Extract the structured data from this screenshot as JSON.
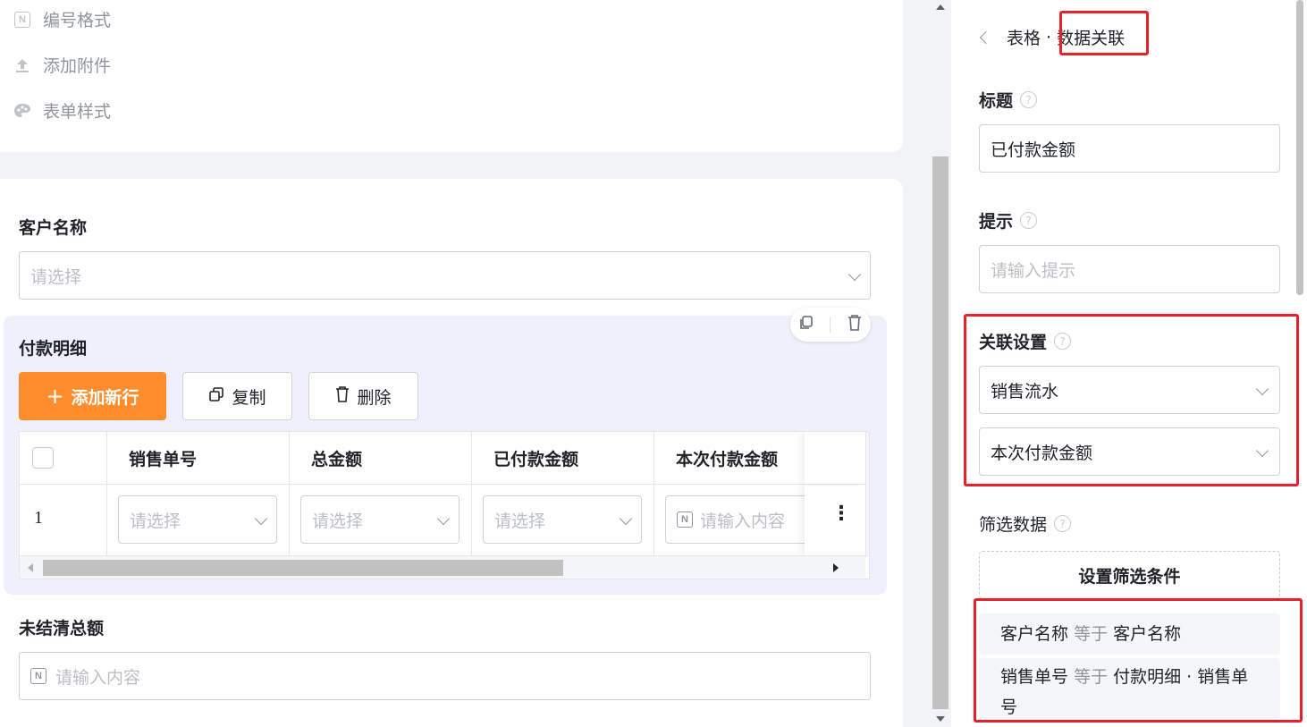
{
  "sidebar_menu": {
    "items": [
      {
        "label": "编号格式",
        "icon": "number-format-icon"
      },
      {
        "label": "添加附件",
        "icon": "upload-icon"
      },
      {
        "label": "表单样式",
        "icon": "palette-icon"
      }
    ]
  },
  "form": {
    "customer_name": {
      "label": "客户名称",
      "placeholder": "请选择"
    },
    "payment_detail": {
      "label": "付款明细",
      "add_row_label": "添加新行",
      "copy_label": "复制",
      "delete_label": "删除",
      "columns": [
        "销售单号",
        "总金额",
        "已付款金额",
        "本次付款金额"
      ],
      "rows": [
        {
          "index": "1",
          "cells": [
            "请选择",
            "请选择",
            "请选择",
            "请输入内容"
          ]
        }
      ]
    },
    "unsettled_total": {
      "label": "未结清总额",
      "placeholder": "请输入内容"
    }
  },
  "panel": {
    "breadcrumb_parent": "表格",
    "breadcrumb_separator": "·",
    "breadcrumb_current": "数据关联",
    "title_label": "标题",
    "title_value": "已付款金额",
    "hint_label": "提示",
    "hint_placeholder": "请输入提示",
    "relation_label": "关联设置",
    "relation_source": "销售流水",
    "relation_field": "本次付款金额",
    "filter_label": "筛选数据",
    "filter_button": "设置筛选条件",
    "conditions": [
      {
        "left": "客户名称",
        "op": "等于",
        "right": "客户名称"
      },
      {
        "left": "销售单号",
        "op": "等于",
        "right": "付款明细 · 销售单号"
      }
    ],
    "help_glyph": "?"
  },
  "colors": {
    "primary_button": "#ff8d2d",
    "highlight_border": "#e8202a",
    "subform_bg": "#eef1fb"
  }
}
